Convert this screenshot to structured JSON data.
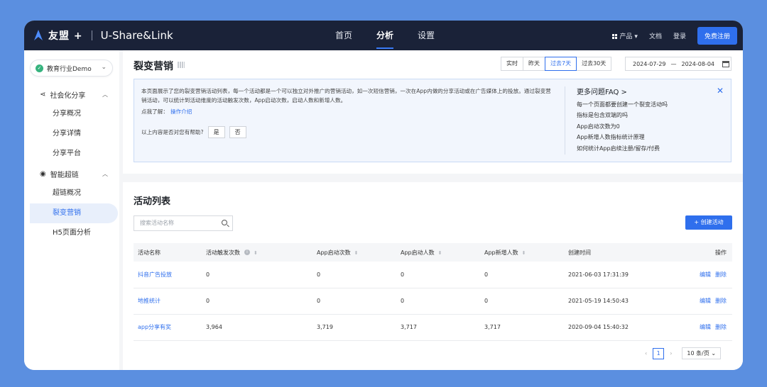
{
  "topbar": {
    "brand_cn": "友盟 +",
    "brand_en": "U-Share&Link",
    "nav": [
      "首页",
      "分析",
      "设置"
    ],
    "active_nav": "分析",
    "product": "产品",
    "docs": "文档",
    "login": "登录",
    "signup": "免费注册"
  },
  "sidebar": {
    "tenant": "教育行业Demo",
    "group1": {
      "label": "社会化分享",
      "items": [
        "分享概况",
        "分享详情",
        "分享平台"
      ]
    },
    "group2": {
      "label": "智能超链",
      "items": [
        "超链概况",
        "裂变营销",
        "H5页面分析"
      ]
    },
    "active_item": "裂变营销"
  },
  "page": {
    "title": "裂变营销",
    "range_tabs": [
      "实时",
      "昨天",
      "过去7天",
      "过去30天"
    ],
    "active_range": "过去7天",
    "date_start": "2024-07-29",
    "date_sep": "—",
    "date_end": "2024-08-04"
  },
  "info": {
    "text": "本页面展示了您的裂变营销活动列表，每一个活动都是一个可以独立对外推广的营销活动，如一次短信营销，一次在App内做的分享活动或在广告媒体上的投放。通过裂变营销活动，可以统计到活动维度的活动触发次数，App启动次数，启动人数和新增人数。",
    "learn_prefix": "点我了解：",
    "learn_link": "操作介绍",
    "help_q": "以上内容是否对您有帮助?",
    "yes": "是",
    "no": "否",
    "faq_title": "更多问题FAQ >",
    "faq": [
      "每一个页面都要创建一个裂变活动吗",
      "指标是包含双端的吗",
      "App启动次数为0",
      "App新增人数指标统计原理",
      "如何统计App启续注册/留存/付费"
    ]
  },
  "list": {
    "title": "活动列表",
    "search_placeholder": "搜索活动名称",
    "create": "+ 创建活动",
    "columns": [
      "活动名称",
      "活动触发次数",
      "App启动次数",
      "App启动人数",
      "App新增人数",
      "创建时间",
      "操作"
    ],
    "rows": [
      {
        "name": "抖音广告投放",
        "trigger": "0",
        "launch": "0",
        "users": "0",
        "new_users": "0",
        "created": "2021-06-03 17:31:39"
      },
      {
        "name": "地推统计",
        "trigger": "0",
        "launch": "0",
        "users": "0",
        "new_users": "0",
        "created": "2021-05-19 14:50:43"
      },
      {
        "name": "app分享有奖",
        "trigger": "3,964",
        "launch": "3,719",
        "users": "3,717",
        "new_users": "3,717",
        "created": "2020-09-04 15:40:32"
      }
    ],
    "edit": "编辑",
    "delete": "删除",
    "page": "1",
    "page_size": "10 条/页"
  }
}
